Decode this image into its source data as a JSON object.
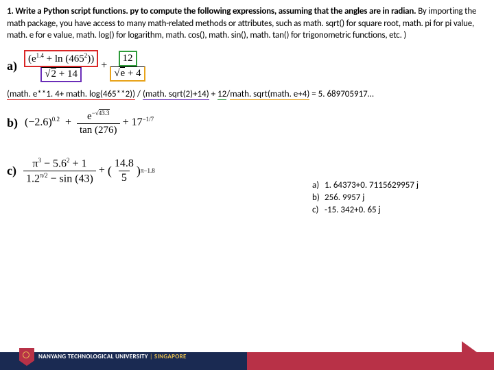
{
  "question": {
    "bold_prefix": "1. Write a Python script functions. py to compute the following expressions, assuming that the angles are in radian.",
    "rest": " By importing the math package, you have access to many math-related methods or attributes, such as math. sqrt() for square root, math. pi for pi value, math. e for e value, math. log() for logarithm, math. cos(), math. sin(), math. tan() for trigonometric functions, etc. )"
  },
  "parts": {
    "a": {
      "label": "a)"
    },
    "b": {
      "label": "b)"
    },
    "c": {
      "label": "c)"
    }
  },
  "expr_a": {
    "num1_box": "(e",
    "num1_exp": "1.4",
    "num1_rest": " + ln (465",
    "num1_sq": "2",
    "num1_close": "))",
    "den1_box_pre": "",
    "den1_sqrt": "2",
    "den1_rest": " + 14",
    "num2": "12",
    "den2_sqrt": "e",
    "den2_rest": " + 4"
  },
  "math_line": {
    "p1": "(math. e**1. 4+ math. log(465**2))",
    "slash1": " / ",
    "p2": "(math. sqrt(2)+14)",
    "plus": " + ",
    "p3": "12",
    "slash2": "/",
    "p4": "math. sqrt(math. e+4)",
    "eq": " = 5. 689705917…"
  },
  "expr_b": {
    "t1": "(−2.6)",
    "t1e": "0.2",
    "t2n_pre": "e",
    "t2n_exp_pre": "−",
    "t2n_sqrt": "43.3",
    "t2d": "tan (276)",
    "t3": "+ 17",
    "t3e": "−1/7"
  },
  "expr_c": {
    "num1": "π",
    "num1e": "3",
    "num1r": " − 5.6",
    "num1r2e": "2",
    "num1end": " + 1",
    "den1": "1.2",
    "den1e": "π/2",
    "den1r": " − sin (43)",
    "frac2n": "14.8",
    "frac2d": "5",
    "exp2": "π−1.8"
  },
  "answers": {
    "a": {
      "l": "a)",
      "v": "1. 64373+0. 7115629957 j"
    },
    "b": {
      "l": "b)",
      "v": "256. 9957 j"
    },
    "c": {
      "l": "c)",
      "v": "-15. 342+0. 65 j"
    }
  },
  "footer": {
    "main": "NANYANG TECHNOLOGICAL UNIVERSITY",
    "sub": "SINGAPORE"
  }
}
